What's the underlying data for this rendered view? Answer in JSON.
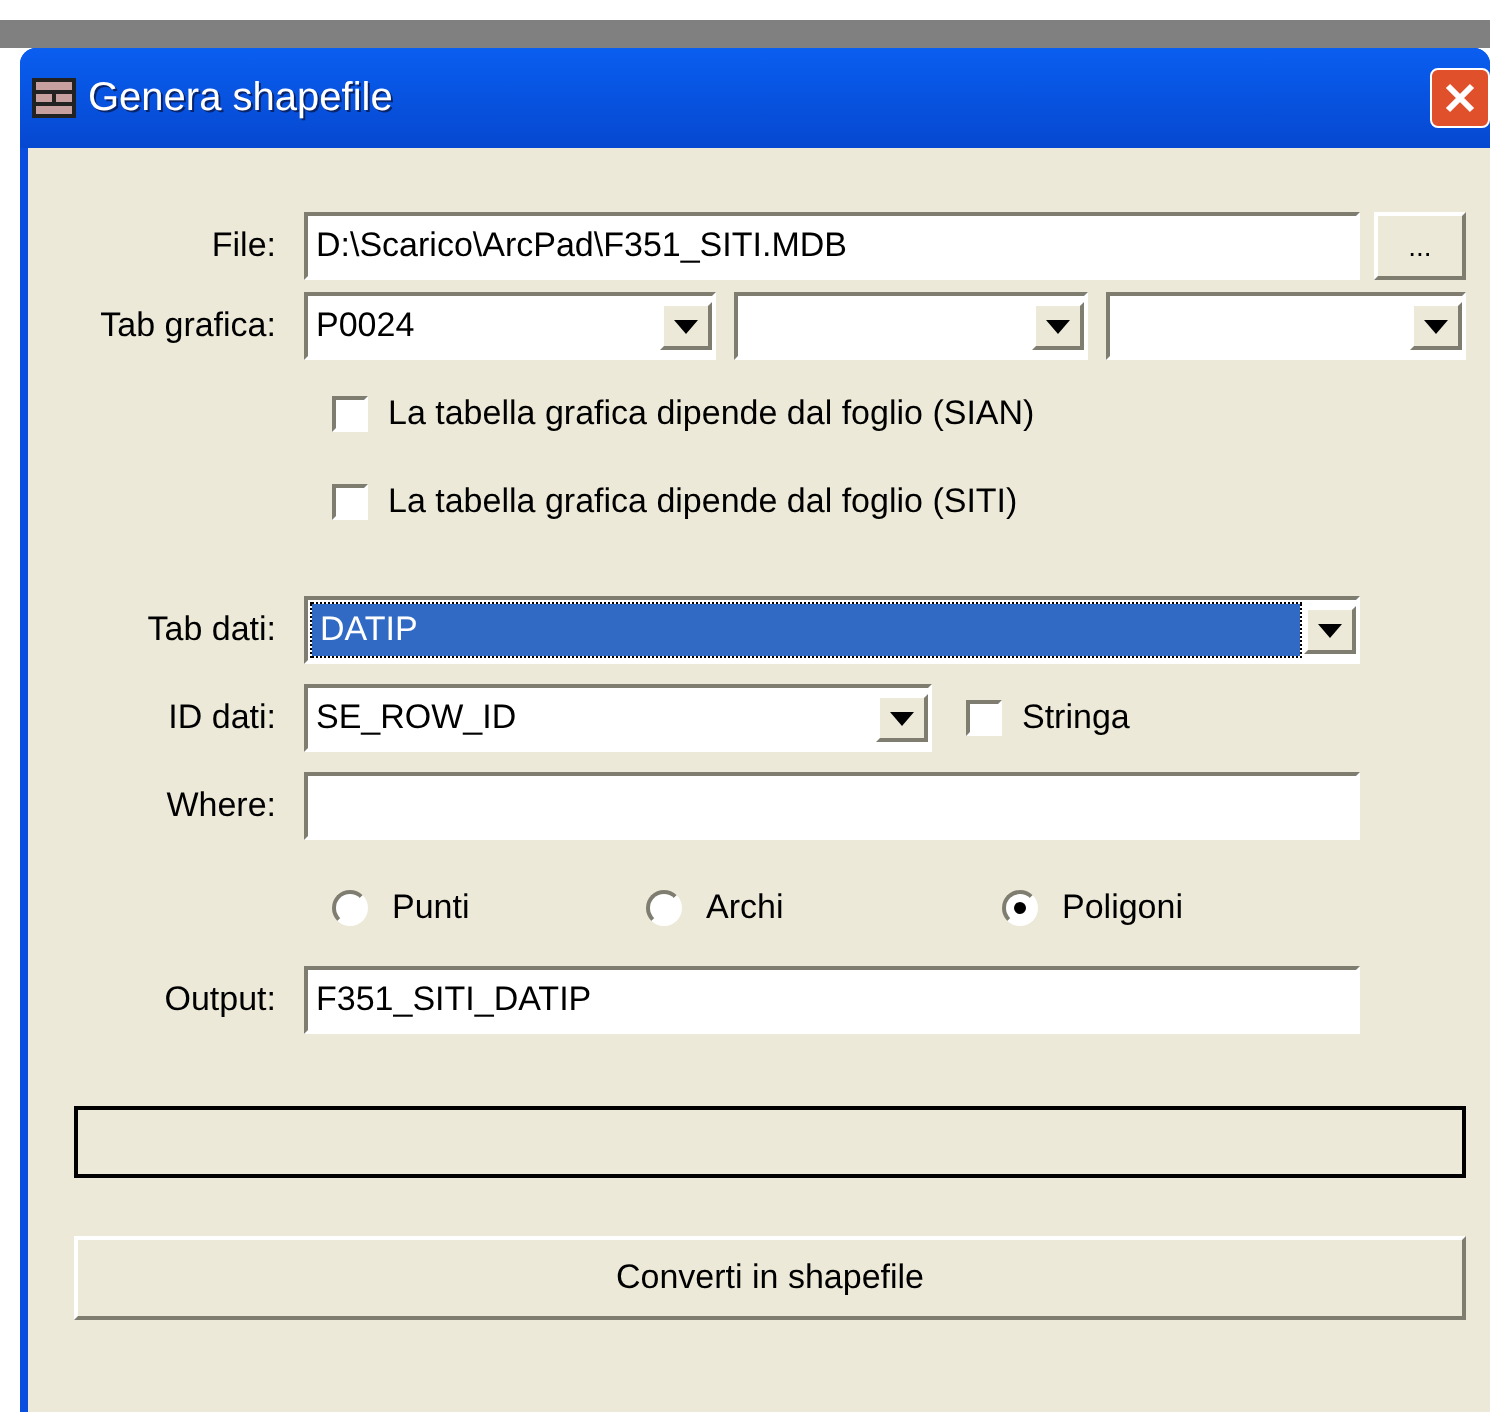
{
  "window": {
    "title": "Genera shapefile"
  },
  "file": {
    "label": "File:",
    "value": "D:\\Scarico\\ArcPad\\F351_SITI.MDB",
    "browse": "..."
  },
  "tab_grafica": {
    "label": "Tab grafica:",
    "value": "P0024",
    "extra_dropdowns": [
      {
        "kind": "dropdown"
      },
      {
        "kind": "dropdown"
      }
    ]
  },
  "options": [
    {
      "label": "La tabella grafica dipende dal foglio (SIAN)",
      "checked": false
    },
    {
      "label": "La tabella grafica dipende dal foglio (SITI)",
      "checked": false
    }
  ],
  "tab_dati": {
    "label": "Tab dati:",
    "value": "DATIP",
    "focused": true
  },
  "id_dati": {
    "label": "ID dati:",
    "value": "SE_ROW_ID",
    "stringa": {
      "label": "Stringa",
      "checked": false
    }
  },
  "where": {
    "label": "Where:"
  },
  "geometry": [
    {
      "label": "Punti",
      "selected": false
    },
    {
      "label": "Archi",
      "selected": false
    },
    {
      "label": "Poligoni",
      "selected": true
    }
  ],
  "output": {
    "label": "Output:",
    "value": "F351_SITI_DATIP"
  },
  "progress": {
    "level": 0
  },
  "convert_button": "Converti in shapefile"
}
